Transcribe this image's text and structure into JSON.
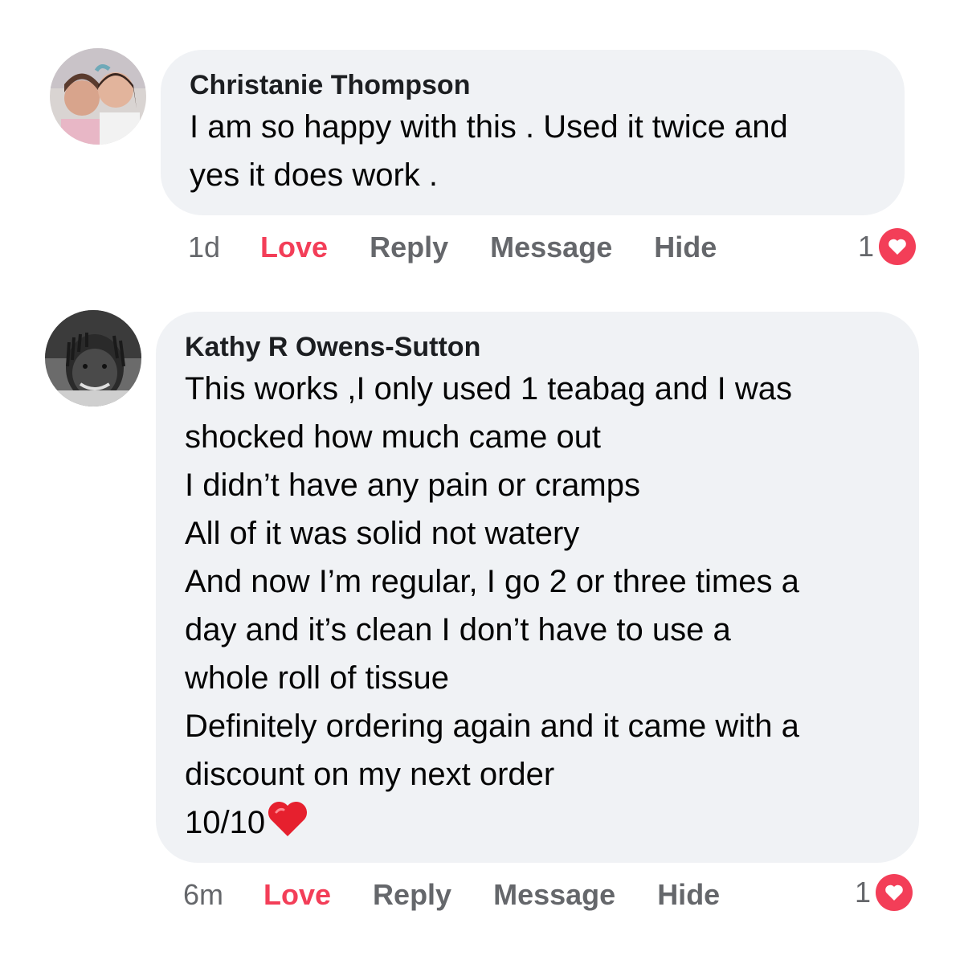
{
  "comments": [
    {
      "author": "Christanie Thompson",
      "lines": [
        "I am so happy with this . Used it twice and",
        "yes it does work ."
      ],
      "time": "1d",
      "love_label": "Love",
      "reply_label": "Reply",
      "message_label": "Message",
      "hide_label": "Hide",
      "reaction_count": "1",
      "reaction_icon": "heart-icon"
    },
    {
      "author": "Kathy R Owens-Sutton",
      "lines": [
        "This works ,I only used 1 teabag and I was",
        "shocked how much came out",
        "I didn’t have any pain or cramps",
        "All of it was solid not watery",
        "And now I’m regular, I go 2 or three times a",
        "day and it’s clean I don’t have to use a",
        "whole roll of tissue",
        "Definitely ordering again and it came with a",
        "discount on my next order",
        "10/10"
      ],
      "time": "6m",
      "love_label": "Love",
      "reply_label": "Reply",
      "message_label": "Message",
      "hide_label": "Hide",
      "reaction_count": "1",
      "reaction_icon": "heart-icon"
    }
  ],
  "colors": {
    "bubble": "#f0f2f5",
    "love": "#f33e58",
    "muted": "#65676b",
    "text": "#050505"
  }
}
